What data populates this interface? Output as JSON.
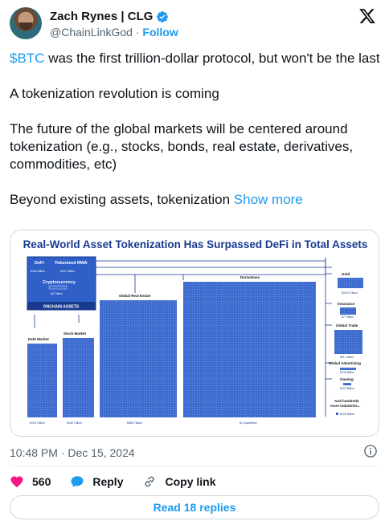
{
  "author": {
    "name": "Zach Rynes | CLG",
    "handle": "@ChainLinkGod",
    "separator": "·",
    "follow_label": "Follow"
  },
  "tweet": {
    "cashtag": "$BTC",
    "line1_rest": " was the first trillion-dollar protocol, but won't be the last",
    "line2": "A tokenization revolution is coming",
    "line3": "The future of the global markets will be centered around tokenization (e.g., stocks, bonds, real estate, derivatives, commodities, etc)",
    "line4": "Beyond existing assets, tokenization ",
    "show_more": "Show more"
  },
  "media": {
    "title": "Real-World Asset Tokenization Has Surpassed DeFi in Total Assets",
    "onchain": {
      "defi_label": "DeFi",
      "defi_value": "$160 Billion",
      "rwa_label": "Tokenized RWA",
      "rwa_value": "$167 Billion",
      "crypto_label": "Cryptocurrency",
      "crypto_value": "$3 Trillion",
      "footer": "ONCHAIN ASSETS"
    },
    "blocks": [
      {
        "label": "Debt Market",
        "value": "$100 Trillion"
      },
      {
        "label": "Stock Market",
        "value": "$106 Trillion"
      },
      {
        "label": "Global Real Estate",
        "value": "$380 Trillion"
      },
      {
        "label": "Derivatives",
        "value": "$1 Quadrillion"
      }
    ],
    "side": [
      {
        "label": "Gold",
        "value": "$15.5 Trillion"
      },
      {
        "label": "Insurance",
        "value": "$7 Trillion"
      },
      {
        "label": "Global Trade",
        "value": "$31 Trillion"
      },
      {
        "label": "Global Advertising",
        "value": "$730 Billion"
      },
      {
        "label": "Gaming",
        "value": "$220 Billion"
      }
    ],
    "more_text_1": "And hundreds",
    "more_text_2": "more industries...",
    "legend_value": "$100 Billion"
  },
  "meta": {
    "timestamp": "10:48 PM · Dec 15, 2024"
  },
  "actions": {
    "like_count": "560",
    "reply_label": "Reply",
    "copy_label": "Copy link",
    "read_replies_label": "Read 18 replies"
  },
  "colors": {
    "brand_blue": "#1d9bf0",
    "chart_blue": "#2f5fc7",
    "chart_dark": "#1a3a8f",
    "like_pink": "#f91880"
  }
}
